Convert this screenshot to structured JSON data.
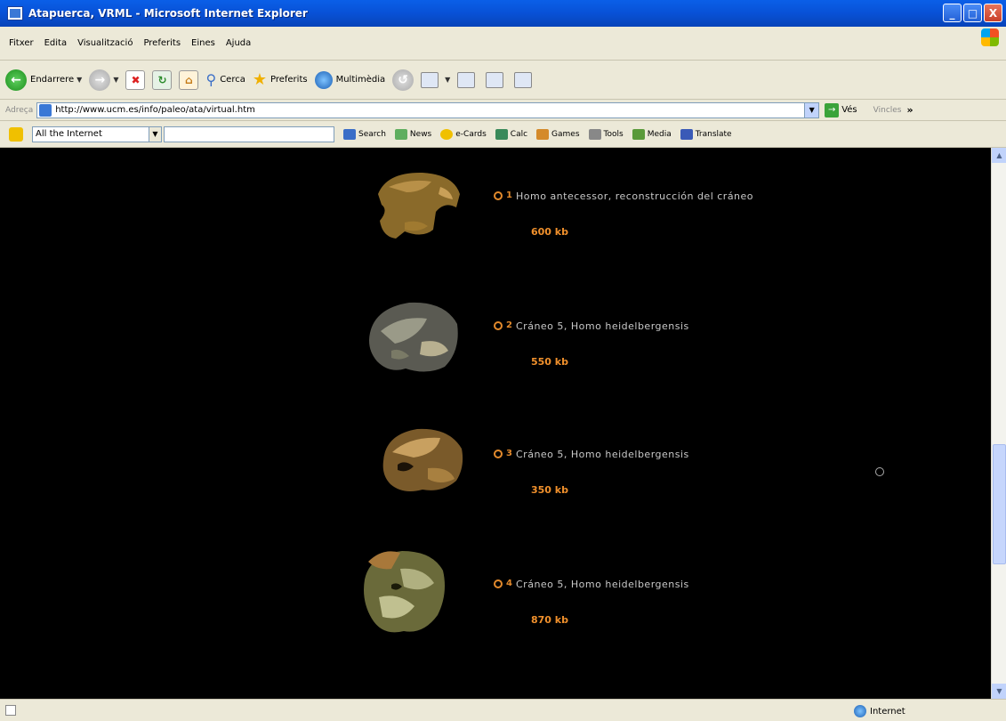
{
  "window": {
    "title": "Atapuerca, VRML - Microsoft Internet Explorer",
    "minimize": "_",
    "maximize": "□",
    "close": "X"
  },
  "menu": [
    "Fitxer",
    "Edita",
    "Visualització",
    "Preferits",
    "Eines",
    "Ajuda"
  ],
  "toolbar": {
    "back": "Endarrere",
    "search": "Cerca",
    "favorites": "Preferits",
    "multimedia": "Multimèdia"
  },
  "address": {
    "label": "Adreça",
    "url": "http://www.ucm.es/info/paleo/ata/virtual.htm",
    "go": "Vés",
    "links": "Vincles"
  },
  "searchbar": {
    "scope": "All the Internet",
    "tools": [
      "Search",
      "News",
      "e-Cards",
      "Calc",
      "Games",
      "Tools",
      "Media",
      "Translate"
    ]
  },
  "entries": [
    {
      "number": "1",
      "title": "Homo antecessor, reconstrucción del cráneo",
      "size": "600 kb"
    },
    {
      "number": "2",
      "title": "Cráneo 5, Homo heidelbergensis",
      "size": "550 kb"
    },
    {
      "number": "3",
      "title": "Cráneo 5, Homo heidelbergensis",
      "size": "350 kb"
    },
    {
      "number": "4",
      "title": "Cráneo 5, Homo heidelbergensis",
      "size": "870 kb"
    }
  ],
  "status": {
    "zone": "Internet"
  }
}
